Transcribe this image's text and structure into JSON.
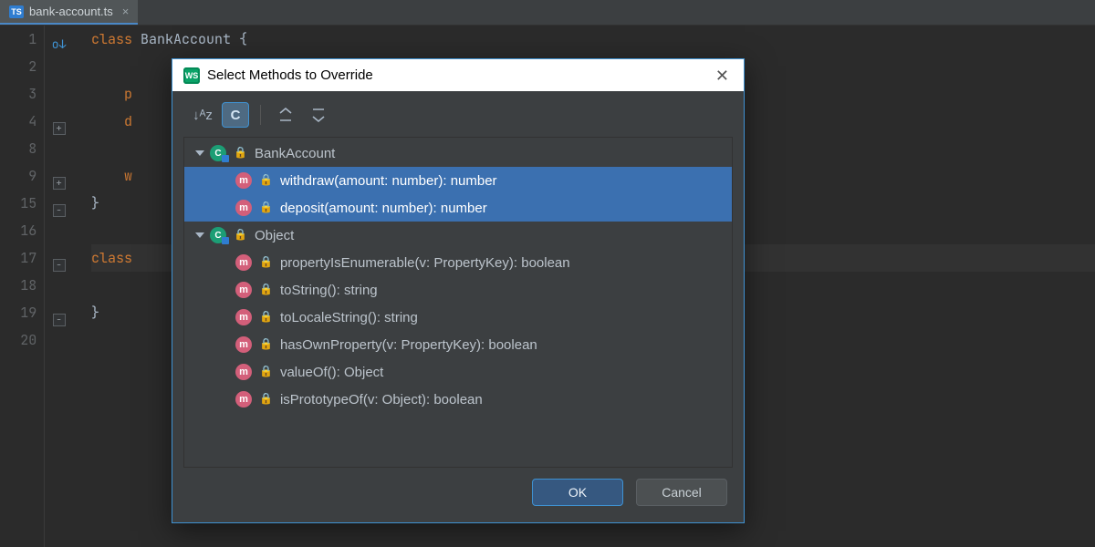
{
  "tab": {
    "filename": "bank-account.ts",
    "lang_badge": "TS"
  },
  "editor": {
    "gutter_lines": [
      "1",
      "2",
      "3",
      "4",
      "8",
      "9",
      "15",
      "16",
      "17",
      "18",
      "19",
      "20"
    ],
    "fold_marks": [
      "-",
      "",
      "",
      "+",
      "",
      "+",
      "-",
      "",
      "-",
      "",
      "-",
      ""
    ],
    "caret_line_index": 8,
    "lines": [
      {
        "pre": "",
        "kw": "class ",
        "rest": "BankAccount {"
      },
      {
        "pre": "",
        "kw": "",
        "rest": ""
      },
      {
        "pre": "    ",
        "kw": "p",
        "rest": ""
      },
      {
        "pre": "    ",
        "kw": "d",
        "rest": ""
      },
      {
        "pre": "",
        "kw": "",
        "rest": ""
      },
      {
        "pre": "    ",
        "kw": "w",
        "rest": ""
      },
      {
        "pre": "",
        "kw": "",
        "rest": "}"
      },
      {
        "pre": "",
        "kw": "",
        "rest": ""
      },
      {
        "pre": "",
        "kw": "class",
        "rest": ""
      },
      {
        "pre": "",
        "kw": "",
        "rest": ""
      },
      {
        "pre": "",
        "kw": "",
        "rest": "}"
      },
      {
        "pre": "",
        "kw": "",
        "rest": ""
      }
    ]
  },
  "dialog": {
    "app_badge": "WS",
    "title": "Select Methods to Override",
    "toolbar": {
      "sort_alpha": "↓ᴬz",
      "copy_jsdoc": "C",
      "expand": "⇱",
      "collapse": "⇲"
    },
    "tree": [
      {
        "type": "class",
        "label": "BankAccount",
        "expanded": true
      },
      {
        "type": "method",
        "label": "withdraw(amount: number): number",
        "selected": true
      },
      {
        "type": "method",
        "label": "deposit(amount: number): number",
        "selected": true
      },
      {
        "type": "class",
        "label": "Object",
        "expanded": true
      },
      {
        "type": "method",
        "label": "propertyIsEnumerable(v: PropertyKey): boolean"
      },
      {
        "type": "method",
        "label": "toString(): string"
      },
      {
        "type": "method",
        "label": "toLocaleString(): string"
      },
      {
        "type": "method",
        "label": "hasOwnProperty(v: PropertyKey): boolean"
      },
      {
        "type": "method",
        "label": "valueOf(): Object"
      },
      {
        "type": "method",
        "label": "isPrototypeOf(v: Object): boolean"
      }
    ],
    "ok": "OK",
    "cancel": "Cancel"
  }
}
